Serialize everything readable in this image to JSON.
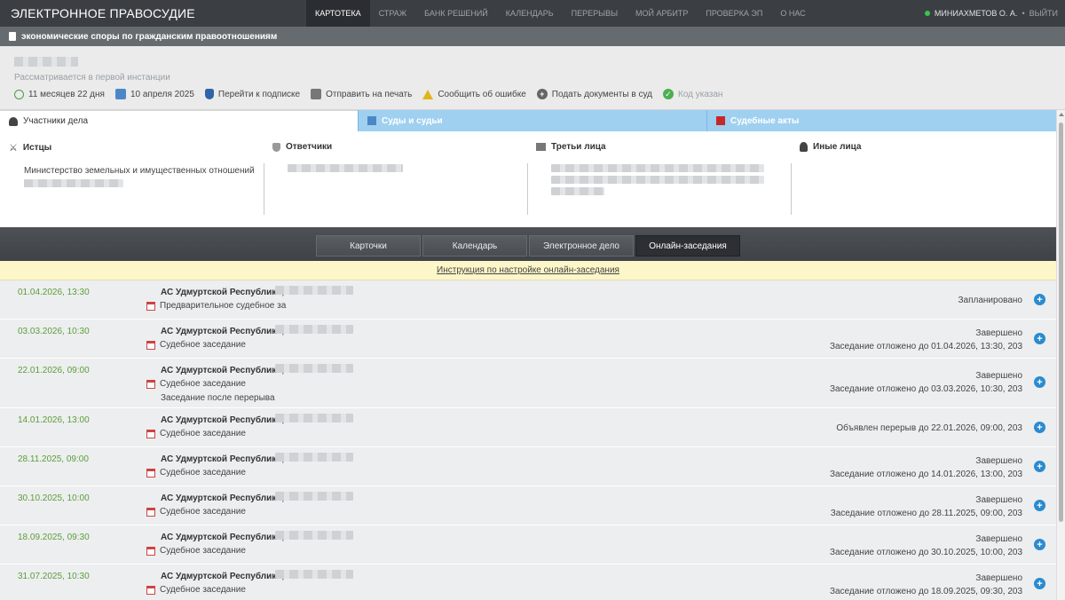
{
  "header": {
    "brand": "ЭЛЕКТРОННОЕ ПРАВОСУДИЕ",
    "nav": [
      {
        "label": "КАРТОТЕКА",
        "active": true
      },
      {
        "label": "СТРАЖ",
        "active": false
      },
      {
        "label": "БАНК РЕШЕНИЙ",
        "active": false
      },
      {
        "label": "КАЛЕНДАРЬ",
        "active": false
      },
      {
        "label": "ПЕРЕРЫВЫ",
        "active": false
      },
      {
        "label": "МОЙ АРБИТР",
        "active": false
      },
      {
        "label": "ПРОВЕРКА ЭП",
        "active": false
      },
      {
        "label": "О НАС",
        "active": false
      }
    ],
    "user": "МИНИАХМЕТОВ О. А.",
    "logout": "ВЫЙТИ"
  },
  "category": "экономические споры по гражданским правоотношениям",
  "case": {
    "status": "Рассматривается в первой инстанции",
    "actions": {
      "duration": "11 месяцев 22 дня",
      "date": "10 апреля 2025",
      "subscribe": "Перейти к подписке",
      "print": "Отправить на печать",
      "report": "Сообщить об ошибке",
      "submit": "Подать документы в суд",
      "code": "Код указан"
    }
  },
  "panels": {
    "participants": "Участники дела",
    "courts": "Суды и судьи",
    "acts": "Судебные акты"
  },
  "participants": {
    "plaintiffs_label": "Истцы",
    "defendants_label": "Ответчики",
    "third_label": "Третьи лица",
    "other_label": "Иные лица",
    "plaintiff_name": "Министерство земельных и имущественных отношений"
  },
  "subtabs": [
    "Карточки",
    "Календарь",
    "Электронное дело",
    "Онлайн-заседания"
  ],
  "instruction": "Инструкция по настройке онлайн-заседания",
  "court_name": "АС Удмуртской Республики,",
  "sessions": [
    {
      "date": "01.04.2026, 13:30",
      "type": "Предварительное судебное за",
      "status": "Запланировано",
      "note": ""
    },
    {
      "date": "03.03.2026, 10:30",
      "type": "Судебное заседание",
      "status": "Завершено",
      "note": "Заседание отложено до 01.04.2026, 13:30, 203"
    },
    {
      "date": "22.01.2026, 09:00",
      "type": "Судебное заседание",
      "extra": "Заседание после перерыва",
      "status": "Завершено",
      "note": "Заседание отложено до 03.03.2026, 10:30, 203"
    },
    {
      "date": "14.01.2026, 13:00",
      "type": "Судебное заседание",
      "status": "Объявлен перерыв до 22.01.2026, 09:00, 203",
      "note": ""
    },
    {
      "date": "28.11.2025, 09:00",
      "type": "Судебное заседание",
      "status": "Завершено",
      "note": "Заседание отложено до 14.01.2026, 13:00, 203"
    },
    {
      "date": "30.10.2025, 10:00",
      "type": "Судебное заседание",
      "status": "Завершено",
      "note": "Заседание отложено до 28.11.2025, 09:00, 203"
    },
    {
      "date": "18.09.2025, 09:30",
      "type": "Судебное заседание",
      "status": "Завершено",
      "note": "Заседание отложено до 30.10.2025, 10:00, 203"
    },
    {
      "date": "31.07.2025, 10:30",
      "type": "Судебное заседание",
      "status": "Завершено",
      "note": "Заседание отложено до 18.09.2025, 09:30, 203"
    }
  ]
}
